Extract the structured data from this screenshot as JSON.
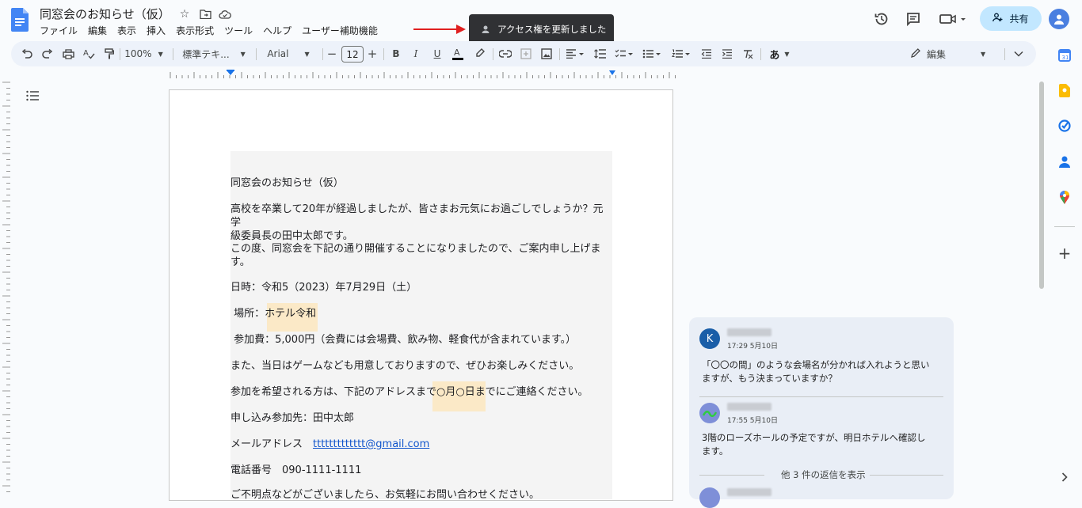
{
  "document": {
    "title": "同窓会のお知らせ（仮）"
  },
  "menu": [
    "ファイル",
    "編集",
    "表示",
    "挿入",
    "表示形式",
    "ツール",
    "ヘルプ",
    "ユーザー補助機能"
  ],
  "toast": {
    "message": "アクセス権を更新しました"
  },
  "header": {
    "share_label": "共有"
  },
  "toolbar": {
    "zoom": "100%",
    "style": "標準テキ...",
    "font": "Arial",
    "font_size": "12",
    "mode": "編集",
    "input_tool": "あ"
  },
  "body": {
    "heading": "同窓会のお知らせ（仮）",
    "p1_line1": "高校を卒業して20年が経過しましたが、皆さまお元気にお過ごしでしょうか？元学",
    "p1_line2": "級委員長の田中太郎です。",
    "p2_line1": "この度、同窓会を下記の通り開催することになりましたので、ご案内申し上げま",
    "p2_line2": "す。",
    "date": "日時：令和5（2023）年7月29日（土）",
    "place_label": " 場所：",
    "place_value": "ホテル令和",
    "fee": " 参加費：5,000円（会費には会場費、飲み物、軽食代が含まれています。）",
    "games": "また、当日はゲームなども用意しておりますので、ぜひお楽しみください。",
    "contact_prefix": "参加を希望される方は、下記のアドレスまで",
    "contact_highlight": "○月○日まで",
    "contact_suffix": "にご連絡ください。",
    "applicant": "申し込み参加先：田中太郎",
    "mail_label": "メールアドレス　",
    "mail_value": "ttttttttttttt@gmail.com",
    "phone": "電話番号　090-1111-1111",
    "last_line": "ご不明点などがございましたら、お気軽にお問い合わせください。"
  },
  "comments": {
    "first": {
      "avatar_letter": "K",
      "time": "17:29 5月10日",
      "text_line1": "「〇〇の間」のような会場名が分かれば入れようと思い",
      "text_line2": "ますが、もう決まっていますか？"
    },
    "second": {
      "time": "17:55 5月10日",
      "text_line1": "3階のローズホールの予定ですが、明日ホテルへ確認し",
      "text_line2": "ます。"
    },
    "more_replies": "他 3 件の返信を表示"
  },
  "colors": {
    "accent": "#1a73e8",
    "share_bg": "#c2e7ff",
    "toolbar_bg": "#edf2fa",
    "highlight": "#fbe9c7",
    "toast_bg": "#303134",
    "arrow": "#e02020"
  }
}
